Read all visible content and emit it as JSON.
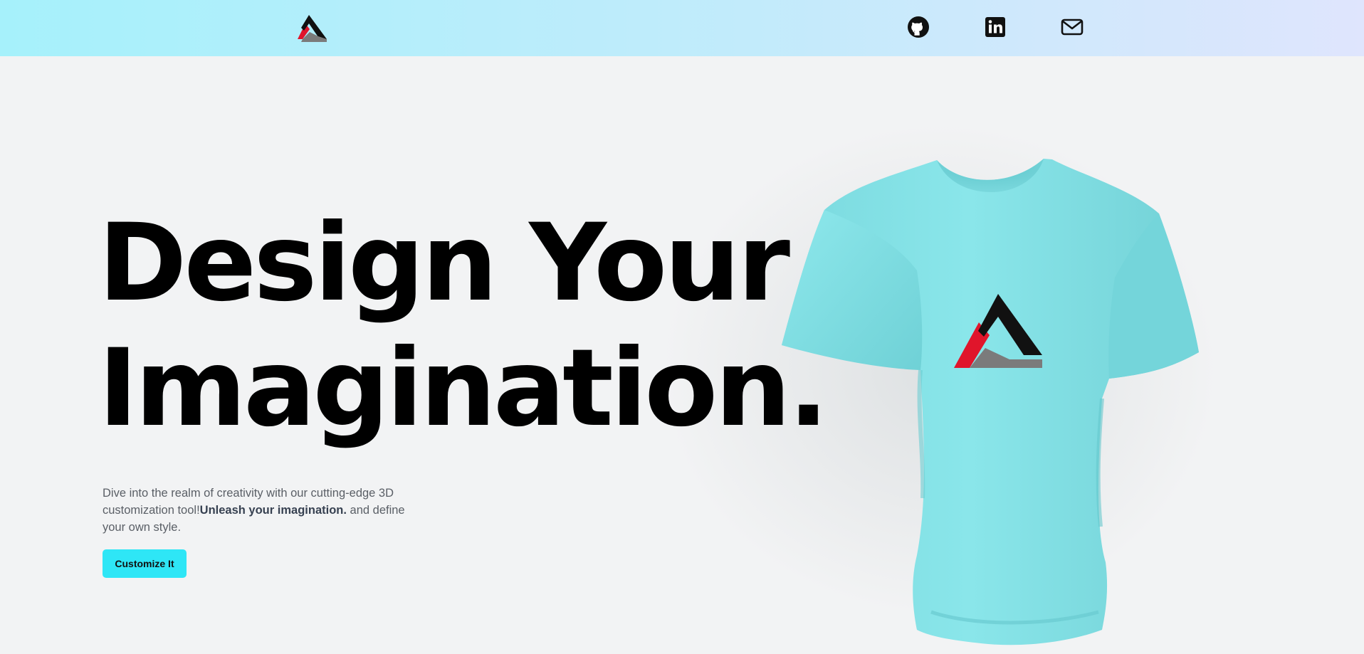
{
  "nav": {
    "logo": "threejs-logo",
    "links": [
      {
        "icon": "github-icon"
      },
      {
        "icon": "linkedin-icon"
      },
      {
        "icon": "mail-icon"
      }
    ]
  },
  "hero": {
    "headline_line1": "Design Your",
    "headline_line2": "Imagination.",
    "description_start": "Dive into the realm of creativity with our cutting-edge 3D customization tool!",
    "description_bold": "Unleash your imagination.",
    "description_end": " and define your own style.",
    "cta_label": "Customize It"
  },
  "shirt": {
    "color": "#7fe0e4",
    "decal": "triangle-logo"
  },
  "colors": {
    "accent": "#2ee6f6",
    "navbar_start": "#a6f1fb",
    "navbar_end": "#dfe5fd",
    "logo_red": "#e0152b",
    "logo_black": "#000000",
    "logo_gray": "#7b7b7b"
  }
}
